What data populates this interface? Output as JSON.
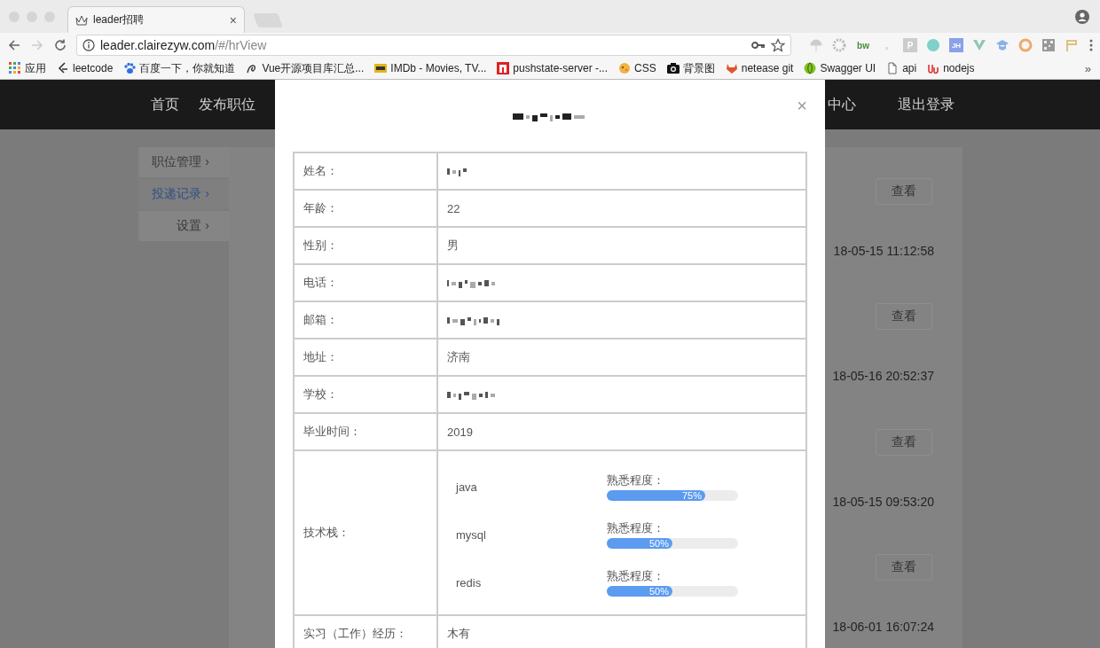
{
  "browser": {
    "tab": {
      "title": "leader招聘",
      "close": "×"
    },
    "address": {
      "host": "leader.clairezyw.com",
      "path": "/#/hrView"
    },
    "extensions": [
      {
        "kind": "parachute"
      },
      {
        "kind": "gear"
      },
      {
        "kind": "text",
        "label": "bw"
      },
      {
        "kind": "blank"
      },
      {
        "kind": "badge",
        "label": "P"
      },
      {
        "kind": "dot"
      },
      {
        "kind": "badge",
        "label": "JH"
      },
      {
        "kind": "vee"
      },
      {
        "kind": "cap"
      },
      {
        "kind": "ring"
      },
      {
        "kind": "qr"
      },
      {
        "kind": "flag"
      }
    ],
    "bookmarks": [
      {
        "kind": "apps",
        "label": "应用"
      },
      {
        "kind": "leetcode",
        "label": "leetcode"
      },
      {
        "kind": "paw",
        "label": "百度一下，你就知道"
      },
      {
        "kind": "swirl",
        "label": "Vue开源项目库汇总..."
      },
      {
        "kind": "imdb",
        "label": "IMDb - Movies, TV..."
      },
      {
        "kind": "square",
        "label": "pushstate-server -..."
      },
      {
        "kind": "bird",
        "label": "CSS"
      },
      {
        "kind": "camera",
        "label": "背景图"
      },
      {
        "kind": "fox",
        "label": "netease git"
      },
      {
        "kind": "globe",
        "label": "Swagger UI"
      },
      {
        "kind": "file",
        "label": "api"
      },
      {
        "kind": "node",
        "label": "nodejs"
      }
    ],
    "overflow": "»"
  },
  "nav": {
    "left": [
      {
        "label": "首页"
      },
      {
        "label": "发布职位"
      }
    ],
    "right": [
      {
        "label": "中心"
      },
      {
        "label": "退出登录"
      }
    ]
  },
  "sidebar": [
    {
      "label": "职位管理",
      "arrow": "›",
      "selected": false
    },
    {
      "label": "投递记录",
      "arrow": "›",
      "selected": true
    },
    {
      "label": "设置",
      "arrow": "›",
      "selected": false
    }
  ],
  "records": [
    {
      "button": "查看",
      "time": "18-05-15 11:12:58"
    },
    {
      "button": "查看",
      "time": "18-05-16 20:52:37"
    },
    {
      "button": "查看",
      "time": "18-05-15 09:53:20"
    },
    {
      "button": "查看",
      "time": "18-06-01 16:07:24"
    }
  ],
  "modal": {
    "title_redacted": true,
    "close": "×",
    "fields": [
      {
        "label": "姓名：",
        "redacted": true
      },
      {
        "label": "年龄：",
        "value": "22"
      },
      {
        "label": "性别：",
        "value": "男"
      },
      {
        "label": "电话：",
        "redacted": true
      },
      {
        "label": "邮箱：",
        "redacted": true
      },
      {
        "label": "地址：",
        "value": "济南"
      },
      {
        "label": "学校：",
        "redacted": true
      },
      {
        "label": "毕业时间：",
        "value": "2019"
      }
    ],
    "skills": {
      "label": "技术栈：",
      "items": [
        {
          "name": "java",
          "caption": "熟悉程度：",
          "level": 0.75,
          "reading": "75%"
        },
        {
          "name": "mysql",
          "caption": "熟悉程度：",
          "level": 0.5,
          "reading": "50%"
        },
        {
          "name": "redis",
          "caption": "熟悉程度：",
          "level": 0.5,
          "reading": "50%"
        }
      ]
    },
    "experience": {
      "label": "实习（工作）经历：",
      "value": "木有"
    }
  }
}
